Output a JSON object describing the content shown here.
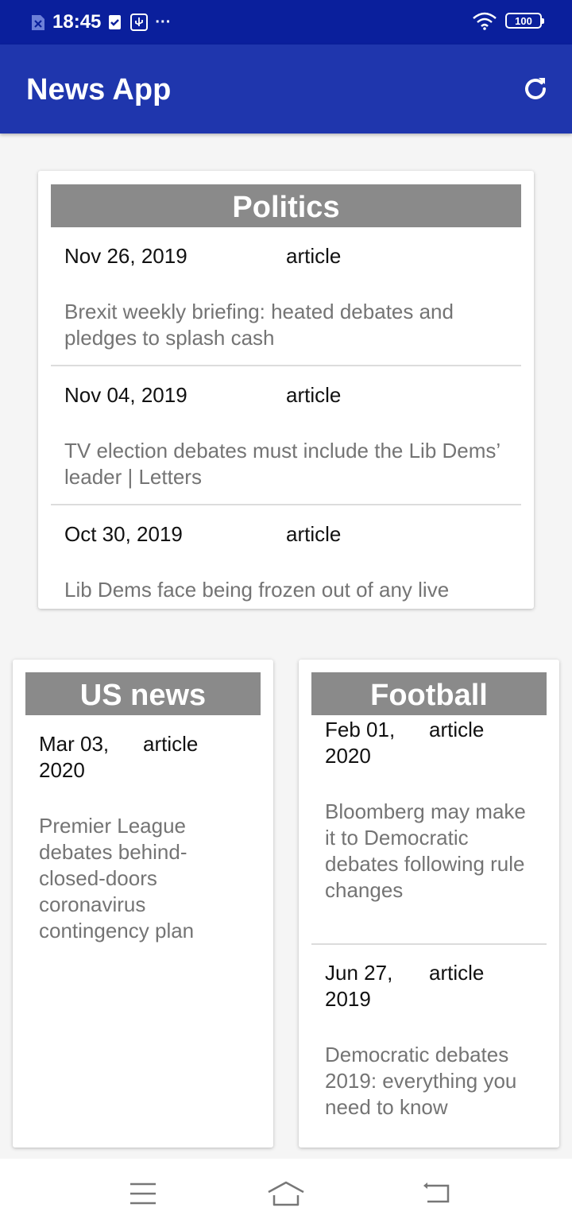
{
  "status_bar": {
    "time": "18:45",
    "more": "···",
    "battery": "100"
  },
  "app_bar": {
    "title": "News App"
  },
  "sections": {
    "politics": {
      "title": "Politics",
      "articles": [
        {
          "date": "Nov 26, 2019",
          "type": "article",
          "headline": "Brexit weekly briefing: heated debates and pledges to splash cash"
        },
        {
          "date": "Nov 04, 2019",
          "type": "article",
          "headline": "TV election debates must include the Lib Dems’ leader | Letters"
        },
        {
          "date": "Oct 30, 2019",
          "type": "article",
          "headline": "Lib Dems face being frozen out of any live"
        }
      ]
    },
    "us_news": {
      "title": "US news",
      "articles": [
        {
          "date": "Mar 03, 2020",
          "type": "article",
          "headline": "Premier League debates behind-closed-doors coronavirus contingency plan"
        }
      ]
    },
    "football": {
      "title": "Football",
      "articles": [
        {
          "date": "Feb 01, 2020",
          "type": "article",
          "headline": "Bloomberg may make it to Democratic debates following rule changes"
        },
        {
          "date": "Jun 27, 2019",
          "type": "article",
          "headline": "Democratic debates 2019: everything you need to know"
        }
      ]
    }
  },
  "colors": {
    "status_bar": "#0a1f9c",
    "app_bar": "#1f36ad",
    "section_header": "#8a8a8a",
    "headline_text": "#747474"
  },
  "icons": {
    "refresh": "refresh-icon",
    "menu": "menu-icon",
    "home": "home-icon",
    "back": "back-icon",
    "wifi": "wifi-icon",
    "sim": "sim-off-icon",
    "check": "check-icon",
    "usb": "usb-icon"
  }
}
